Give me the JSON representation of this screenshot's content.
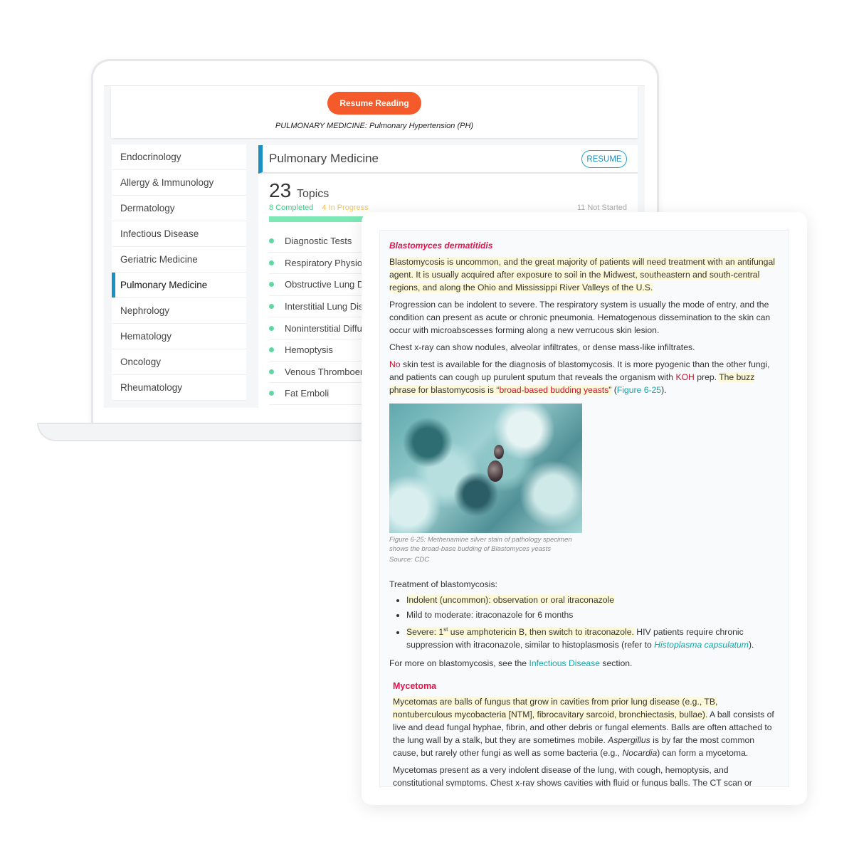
{
  "laptop": {
    "resume_reading": "Resume Reading",
    "breadcrumb": {
      "section": "PULMONARY MEDICINE:",
      "topic": "Pulmonary Hypertension (PH)"
    },
    "sidebar": [
      "Endocrinology",
      "Allergy & Immunology",
      "Dermatology",
      "Infectious Disease",
      "Geriatric Medicine",
      "Pulmonary Medicine",
      "Nephrology",
      "Hematology",
      "Oncology",
      "Rheumatology"
    ],
    "active_item": "Pulmonary Medicine",
    "main": {
      "title": "Pulmonary Medicine",
      "resume": "RESUME",
      "count": "23",
      "count_label": "Topics",
      "completed": "8 Completed",
      "in_progress": "4 In Progress",
      "not_started": "11 Not Started",
      "progress": {
        "completed": 8,
        "in_progress": 4,
        "not_started": 11,
        "total": 23
      },
      "topics": [
        "Diagnostic Tests",
        "Respiratory Physiology",
        "Obstructive Lung Disease",
        "Interstitial Lung Disease",
        "Noninterstitial Diffuse Lung Disease",
        "Hemoptysis",
        "Venous Thromboembolism",
        "Fat Emboli"
      ]
    }
  },
  "colors": {
    "accent": "#1a8fc4",
    "resume_button": "#f45a2a",
    "completed": "#3ccf86",
    "in_progress": "#f2c15a",
    "heading": "#e0144c",
    "link": "#17a5a8",
    "highlight": "#fdf9d8"
  },
  "reader": {
    "heading": "Blastomyces dermatitidis",
    "p1": "Blastomycosis is uncommon, and the great majority of patients will need treatment with an antifungal agent. It is usually acquired after exposure to soil in the Midwest, southeastern and south-central regions, and along the Ohio and Mississippi River Valleys of the U.S.",
    "p2": "Progression can be indolent to severe. The respiratory system is usually the mode of entry, and the condition can present as acute or chronic pneumonia. Hematogenous dissemination to the skin can occur with microabscesses forming along a new verrucous skin lesion.",
    "p3": "Chest x-ray can show nodules, alveolar infiltrates, or dense mass-like infiltrates.",
    "p4": {
      "no": "No",
      "a": " skin test is available for the diagnosis of blastomycosis. It is more pyogenic than the other fungi, and patients can cough up purulent sputum that reveals the organism with ",
      "koh": "KOH",
      "b": " prep. ",
      "c": "The buzz phrase for blastomycosis is “",
      "buzz": "broad-based budding yeasts",
      "d": "”",
      "e": " (",
      "fig": "Figure 6-25",
      "f": ")."
    },
    "caption": "Figure 6-25: Methenamine silver stain of pathology specimen shows the broad-base budding of Blastomyces yeasts",
    "source": "Source: CDC",
    "treatment_title": "Treatment of blastomycosis:",
    "treatment": {
      "t1": "Indolent (uncommon): observation or oral itraconazole",
      "t2": "Mild to moderate: itraconazole for 6 months",
      "t3a": "Severe: 1",
      "t3sup": "st",
      "t3b": " use amphotericin B, then switch to itraconazole.",
      "t3c": " HIV patients require chronic suppression with itraconazole, similar to histoplasmosis (refer to ",
      "t3link": "Histoplasma capsulatum",
      "t3d": ")."
    },
    "more": {
      "a": "For more on blastomycosis, see the ",
      "link": "Infectious Disease",
      "b": " section."
    },
    "heading2": "Mycetoma",
    "m1": {
      "hl": "Mycetomas are balls of fungus that grow in cavities from prior lung disease (e.g., TB, nontuberculous mycobacteria [NTM], fibrocavitary sarcoid, bronchiectasis, bullae).",
      "a": " A ball consists of live and dead fungal hyphae, fibrin, and other debris or fungal elements. Balls are often attached to the lung wall by a stalk, but they are sometimes mobile. ",
      "asp": "Aspergillus",
      "b": " is by far the most common cause, but rarely other fungi as well as some bacteria (e.g., ",
      "noc": "Nocardia",
      "c": ") can form a mycetoma."
    },
    "m2": "Mycetomas present as a very indolent disease of the lung, with cough, hemoptysis, and constitutional symptoms. Chest x-ray shows cavities with fluid or fungus balls. The CT scan or occasionally the chest"
  }
}
